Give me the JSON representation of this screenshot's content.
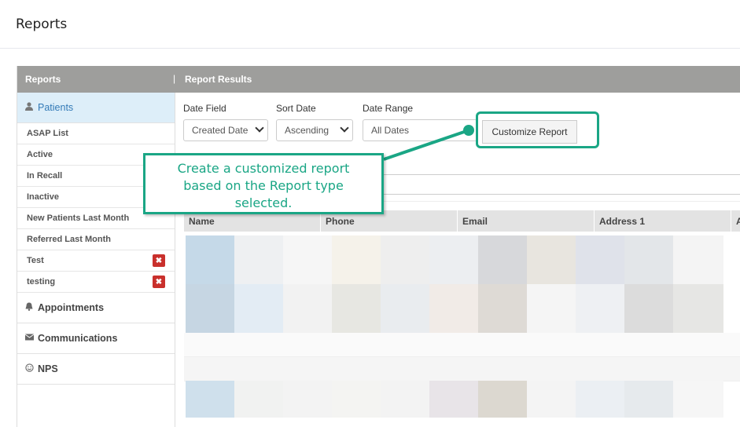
{
  "page": {
    "title": "Reports"
  },
  "panel": {
    "left_title": "Reports",
    "separator": "|",
    "right_title": "Report Results"
  },
  "sidebar": {
    "patients": {
      "label": "Patients",
      "icon": "user-icon"
    },
    "items": [
      {
        "label": "ASAP List",
        "deletable": false
      },
      {
        "label": "Active",
        "deletable": false
      },
      {
        "label": "In Recall",
        "deletable": false
      },
      {
        "label": "Inactive",
        "deletable": false
      },
      {
        "label": "New Patients Last Month",
        "deletable": false
      },
      {
        "label": "Referred Last Month",
        "deletable": false
      },
      {
        "label": "Test",
        "deletable": true
      },
      {
        "label": "testing",
        "deletable": true
      }
    ],
    "appointments": {
      "label": "Appointments",
      "icon": "bell-icon"
    },
    "communications": {
      "label": "Communications",
      "icon": "envelope-icon"
    },
    "nps": {
      "label": "NPS",
      "icon": "smiley-icon"
    },
    "delete_glyph": "✖"
  },
  "filters": {
    "date_field": {
      "label": "Date Field",
      "value": "Created Date"
    },
    "sort_date": {
      "label": "Sort Date",
      "value": "Ascending"
    },
    "date_range": {
      "label": "Date Range",
      "value": "All Dates"
    },
    "customize_label": "Customize Report"
  },
  "table": {
    "columns": [
      "Name",
      "Phone",
      "Email",
      "Address 1",
      "A"
    ]
  },
  "callout": {
    "line1": "Create a customized report",
    "line2": "based on the Report type",
    "line3": "selected."
  },
  "colors": {
    "accent": "#1aa685",
    "bar": "#9e9e9c",
    "active_bg": "#ddeef9",
    "link": "#337ab7",
    "danger": "#c9302c"
  }
}
